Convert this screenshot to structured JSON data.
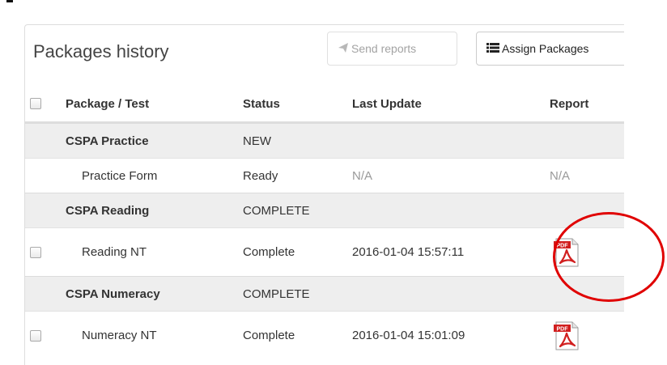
{
  "panel": {
    "title": "Packages history",
    "send_reports_label": "Send reports",
    "assign_packages_label": "Assign Packages"
  },
  "table": {
    "columns": [
      "Package / Test",
      "Status",
      "Last Update",
      "Report"
    ],
    "rows": [
      {
        "type": "group",
        "name": "CSPA Practice",
        "status": "NEW",
        "last_update": "",
        "report": ""
      },
      {
        "type": "item",
        "name": "Practice Form",
        "status": "Ready",
        "last_update": "N/A",
        "report": "N/A",
        "checkbox": false
      },
      {
        "type": "group",
        "name": "CSPA Reading",
        "status": "COMPLETE",
        "last_update": "",
        "report": ""
      },
      {
        "type": "item",
        "name": "Reading NT",
        "status": "Complete",
        "last_update": "2016-01-04 15:57:11",
        "report": "pdf",
        "checkbox": true
      },
      {
        "type": "group",
        "name": "CSPA Numeracy",
        "status": "COMPLETE",
        "last_update": "",
        "report": ""
      },
      {
        "type": "item",
        "name": "Numeracy NT",
        "status": "Complete",
        "last_update": "2016-01-04 15:01:09",
        "report": "pdf",
        "checkbox": true
      }
    ]
  },
  "icons": {
    "send": "paper-plane-icon",
    "assign": "list-icon",
    "report": "pdf-icon"
  },
  "colors": {
    "group_row_bg": "#eeeeee",
    "annotation_circle": "#e00000",
    "pdf_red": "#d11f1f"
  }
}
